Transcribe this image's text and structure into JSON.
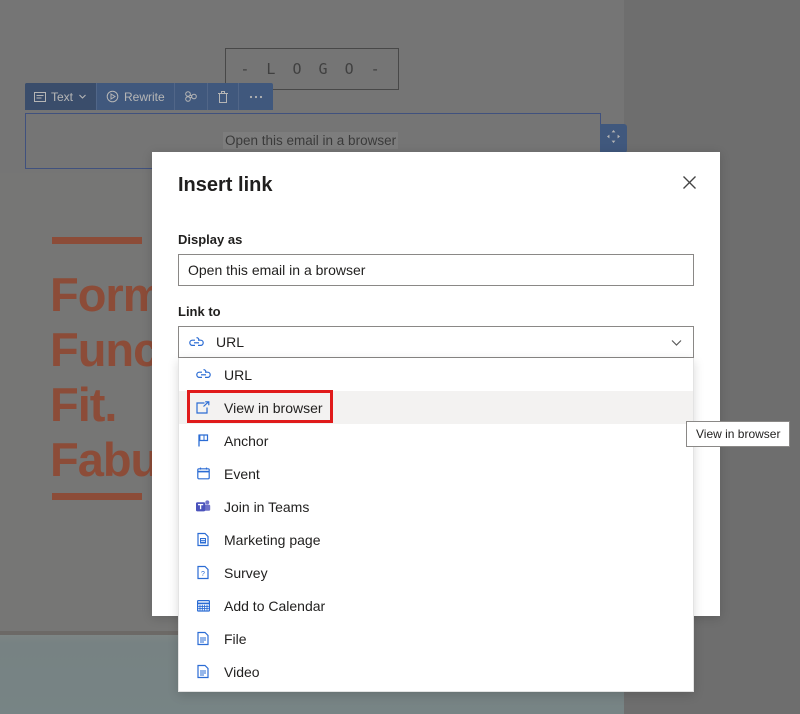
{
  "canvas": {
    "logo_text": "- L O G O -",
    "link_text": "Open this email in a browser",
    "hero_heading_lines": [
      "Form.",
      "Function.",
      "Fit.",
      "Fabulous."
    ],
    "accent_color": "#b4401d"
  },
  "toolbar": {
    "items": [
      {
        "label": "Text",
        "icon": "text-box-icon",
        "has_chevron": true
      },
      {
        "label": "Rewrite",
        "icon": "rewrite-icon",
        "has_chevron": false
      },
      {
        "label": "",
        "icon": "duplicate-icon",
        "has_chevron": false
      },
      {
        "label": "",
        "icon": "trash-icon",
        "has_chevron": false
      },
      {
        "label": "",
        "icon": "more-ellipsis-icon",
        "has_chevron": false
      }
    ],
    "move_handle_icon": "move-arrows-icon",
    "background_color": "#2b579a"
  },
  "dialog": {
    "title": "Insert link",
    "close_icon": "close-icon",
    "display_as": {
      "label": "Display as",
      "value": "Open this email in a browser",
      "placeholder": "Display as"
    },
    "link_to": {
      "label": "Link to",
      "selected_value": "URL",
      "selected_icon": "link-chain-icon",
      "chevron_icon": "chevron-down-icon"
    }
  },
  "dropdown": {
    "options": [
      {
        "label": "URL",
        "icon": "link-chain-icon",
        "selected": false
      },
      {
        "label": "View in browser",
        "icon": "open-in-browser-icon",
        "selected": true
      },
      {
        "label": "Anchor",
        "icon": "flag-icon",
        "selected": false
      },
      {
        "label": "Event",
        "icon": "calendar-icon",
        "selected": false
      },
      {
        "label": "Join in Teams",
        "icon": "teams-icon",
        "selected": false
      },
      {
        "label": "Marketing page",
        "icon": "marketing-page-icon",
        "selected": false
      },
      {
        "label": "Survey",
        "icon": "survey-icon",
        "selected": false
      },
      {
        "label": "Add to Calendar",
        "icon": "add-calendar-icon",
        "selected": false
      },
      {
        "label": "File",
        "icon": "file-icon",
        "selected": false
      },
      {
        "label": "Video",
        "icon": "video-file-icon",
        "selected": false
      }
    ]
  },
  "tooltip": {
    "text": "View in browser"
  },
  "annotation": {
    "color": "#e01b1b",
    "target": "View in browser"
  }
}
